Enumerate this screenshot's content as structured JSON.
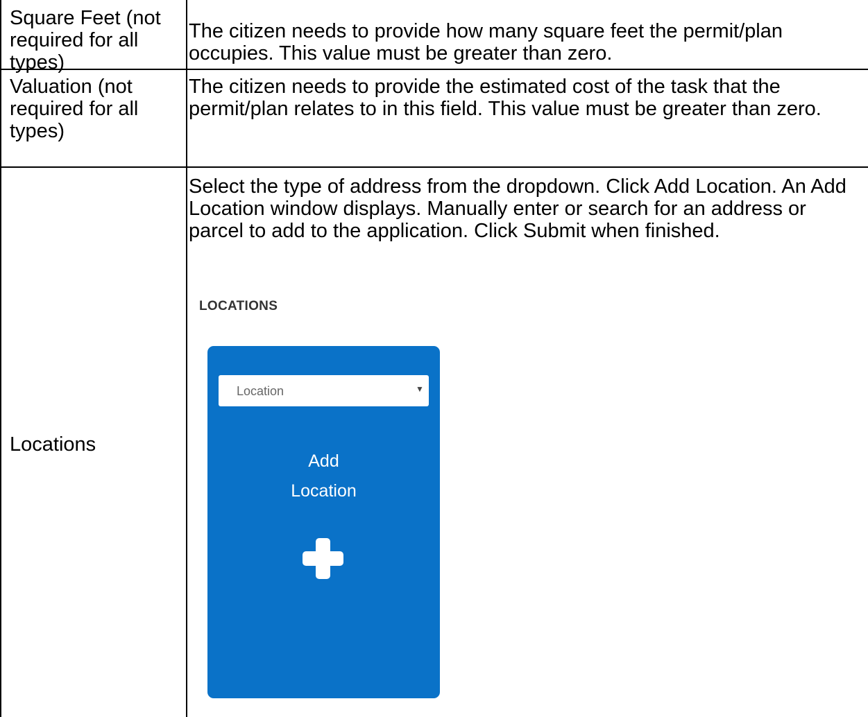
{
  "rows": [
    {
      "label": "Square Feet (not required for all types)",
      "description": "The citizen needs to provide how many square feet the permit/plan occupies. This value must be greater than zero."
    },
    {
      "label": "Valuation (not required for all types)",
      "description": "The citizen needs to provide the estimated cost of the task that the permit/plan relates to in this field. This value must be greater than zero."
    },
    {
      "label": "Locations",
      "description": "Select the type of address from the dropdown. Click Add Location. An Add Location window displays. Manually enter or search for an address or parcel to add to the application. Click Submit when finished."
    }
  ],
  "locations_widget": {
    "heading": "LOCATIONS",
    "select_value": "Location",
    "add_label_line1": "Add",
    "add_label_line2": "Location",
    "card_color": "#0a72c8",
    "plus_icon": "plus-icon",
    "caret_icon": "caret-down-icon"
  }
}
